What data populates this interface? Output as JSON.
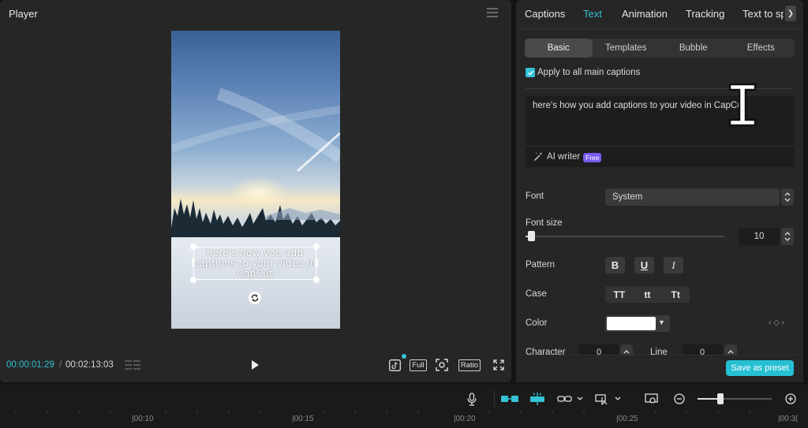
{
  "player": {
    "title": "Player",
    "caption_text": "here's how you add captions to your video in CapCut",
    "time_current": "00:00:01:29",
    "time_separator": "/",
    "time_total": "00:02:13:03",
    "controls": {
      "full_label": "Full",
      "ratio_label": "Ratio"
    }
  },
  "panel": {
    "tabs": [
      "Captions",
      "Text",
      "Animation",
      "Tracking",
      "Text to sp"
    ],
    "active_tab": "Text",
    "subtabs": [
      "Basic",
      "Templates",
      "Bubble",
      "Effects"
    ],
    "active_subtab": "Basic",
    "apply_all_label": "Apply to all main captions",
    "apply_all_checked": true,
    "text_value": "here's how you add captions to your video in CapCut",
    "ai_writer_label": "AI writer",
    "ai_writer_badge": "Free",
    "font_label": "Font",
    "font_value": "System",
    "font_size_label": "Font size",
    "font_size_value": "10",
    "font_size_slider_fraction": 0.03,
    "pattern_label": "Pattern",
    "pattern_buttons": [
      "B",
      "U",
      "I"
    ],
    "case_label": "Case",
    "case_buttons": [
      "TT",
      "tt",
      "Tt"
    ],
    "color_label": "Color",
    "color_value": "#ffffff",
    "character_label": "Character",
    "character_value": "0",
    "line_label": "Line",
    "line_value": "0",
    "save_preset_label": "Save as preset"
  },
  "timeline": {
    "ticks": [
      "|00:10",
      "|00:15",
      "|00:20",
      "|00:25",
      "|00:3("
    ],
    "zoom_fraction": 0.3
  },
  "colors": {
    "accent": "#35c2d6",
    "panel_bg": "#262626",
    "app_bg": "#141414",
    "badge": "#7a5cf0"
  }
}
